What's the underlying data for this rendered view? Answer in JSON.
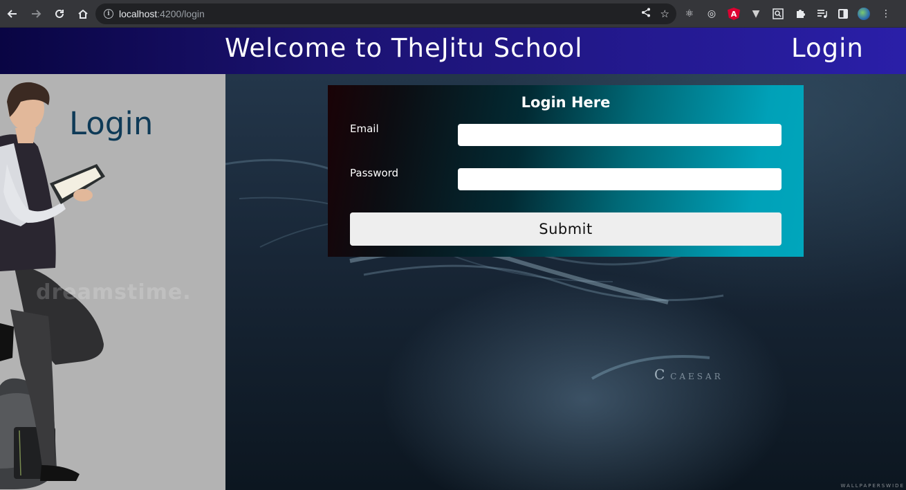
{
  "browser": {
    "url_host": "localhost",
    "url_rest": ":4200/login",
    "back_icon": "arrow-left-icon",
    "forward_icon": "arrow-right-icon",
    "reload_icon": "reload-icon",
    "home_icon": "home-icon",
    "extensions": [
      "react-devtools-icon",
      "target-icon",
      "angular-icon",
      "vue-icon",
      "search-page-icon",
      "puzzle-icon",
      "media-queue-icon",
      "side-panel-icon",
      "profile-avatar-icon",
      "more-menu-icon"
    ]
  },
  "header": {
    "title": "Welcome to TheJitu School",
    "login_link": "Login",
    "gradient_start": "#090543",
    "gradient_end": "#2a1fa8"
  },
  "left_panel": {
    "title": "Login",
    "watermark": "dreamstime.",
    "background": "#b3b3b3",
    "title_color": "#0e3a57"
  },
  "login_form": {
    "heading": "Login Here",
    "email_label": "Email",
    "email_value": "",
    "password_label": "Password",
    "password_value": "",
    "submit_label": "Submit"
  },
  "background": {
    "watermark": "CAESAR",
    "watermark_initial": "C",
    "corner_mark": "WALLPAPERSWIDE"
  }
}
